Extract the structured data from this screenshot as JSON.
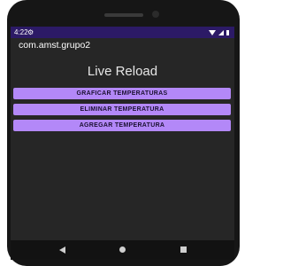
{
  "status_bar": {
    "time": "4:22",
    "settings_icon": "gear-icon",
    "wifi_icon": "wifi-icon",
    "signal_icon": "signal-icon",
    "battery_icon": "battery-icon",
    "background": "#2c1a66"
  },
  "app": {
    "title": "com.amst.grupo2"
  },
  "main": {
    "heading": "Live Reload",
    "buttons": [
      {
        "label": "GRAFICAR TEMPERATURAS"
      },
      {
        "label": "ELIMINAR TEMPERATURA"
      },
      {
        "label": "AGREGAR TEMPERATURA"
      }
    ],
    "button_color": "#b388f8"
  },
  "nav_bar": {
    "back_icon": "back-icon",
    "home_icon": "home-icon",
    "recents_icon": "recents-icon"
  }
}
